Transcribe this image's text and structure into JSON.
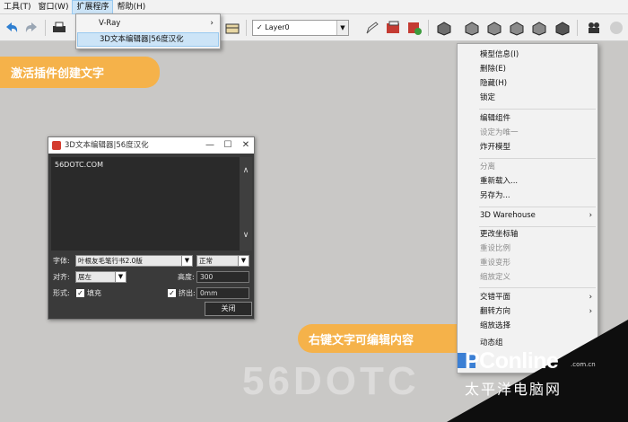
{
  "menubar": {
    "items": [
      "工具(T)",
      "窗口(W)",
      "扩展程序",
      "帮助(H)"
    ]
  },
  "toolbar": {
    "layer": "Layer0"
  },
  "ext_menu": {
    "items": [
      "V-Ray",
      "3D文本编辑器|56度汉化"
    ]
  },
  "pills": {
    "top": "激活插件创建文字",
    "bottom": "右键文字可编辑内容"
  },
  "dialog": {
    "title": "3D文本编辑器|56度汉化",
    "text": "56DOTC.COM",
    "font_label": "字体:",
    "font_value": "叶根友毛笔行书2.0版",
    "style_value": "正常",
    "align_label": "对齐:",
    "align_value": "居左",
    "height_label": "高度:",
    "height_value": "300",
    "form_label": "形式:",
    "fill_label": "填充",
    "extrude_label": "挤出:",
    "extrude_value": "0mm",
    "close": "关闭"
  },
  "context_menu": {
    "items": [
      {
        "label": "模型信息(I)",
        "disabled": false
      },
      {
        "label": "删除(E)",
        "disabled": false
      },
      {
        "label": "隐藏(H)",
        "disabled": false
      },
      {
        "label": "锁定",
        "disabled": false
      },
      {
        "label": "编辑组件",
        "disabled": false
      },
      {
        "label": "设定为唯一",
        "disabled": true
      },
      {
        "label": "炸开模型",
        "disabled": false
      },
      {
        "label": "分离",
        "disabled": true
      },
      {
        "label": "重新载入...",
        "disabled": false
      },
      {
        "label": "另存为...",
        "disabled": false
      },
      {
        "label": "3D Warehouse",
        "disabled": false,
        "submenu": true
      },
      {
        "label": "更改坐标轴",
        "disabled": false
      },
      {
        "label": "重设比例",
        "disabled": true
      },
      {
        "label": "重设变形",
        "disabled": true
      },
      {
        "label": "缩放定义",
        "disabled": true
      },
      {
        "label": "交错平面",
        "disabled": false,
        "submenu": true
      },
      {
        "label": "翻转方向",
        "disabled": false,
        "submenu": true
      },
      {
        "label": "缩放选择",
        "disabled": false
      },
      {
        "label": "动态组",
        "disabled": false
      }
    ]
  },
  "watermark": {
    "brand": "PConline",
    "cn": "太平洋电脑网",
    "com": ".com.cn"
  },
  "ghost_text": "56DOTC"
}
